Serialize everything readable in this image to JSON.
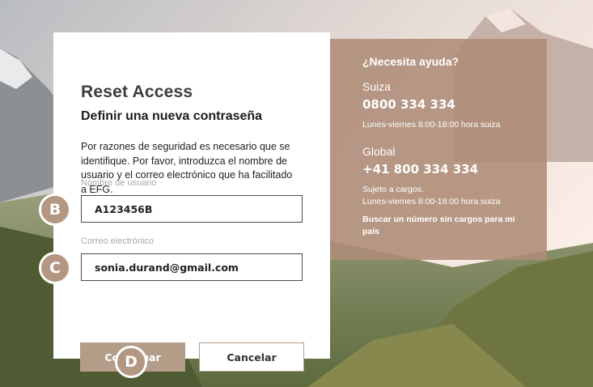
{
  "reset_card": {
    "title": "Reset Access",
    "subtitle": "Definir una nueva contraseña",
    "description": "Por razones de seguridad es necesario que se identifique. Por favor, introduzca el nombre de usuario y el correo electrónico que ha facilitado a EFG.",
    "username": {
      "label": "Nombre de usuario",
      "value": "A123456B"
    },
    "email": {
      "label": "Correo electrónico",
      "value": "sonia.durand@gmail.com"
    },
    "continue_label": "Continuar",
    "cancel_label": "Cancelar"
  },
  "markers": {
    "b": "B",
    "c": "C",
    "d": "D"
  },
  "help_panel": {
    "title": "¿Necesita ayuda?",
    "switzerland": {
      "region": "Suiza",
      "phone": "0800 334 334",
      "hours": "Lunes-viernes 8:00-18:00 hora suiza"
    },
    "global": {
      "region": "Global",
      "phone": "+41 800 334 334",
      "note": "Sujeto a cargos.",
      "hours": "Lunes-viernes 8:00-18:00 hora suiza"
    },
    "link": "Buscar un número sin cargos para mi país"
  },
  "colors": {
    "accent": "#b39d89",
    "help_panel": "#ae8c78",
    "marker": "#b39782"
  }
}
